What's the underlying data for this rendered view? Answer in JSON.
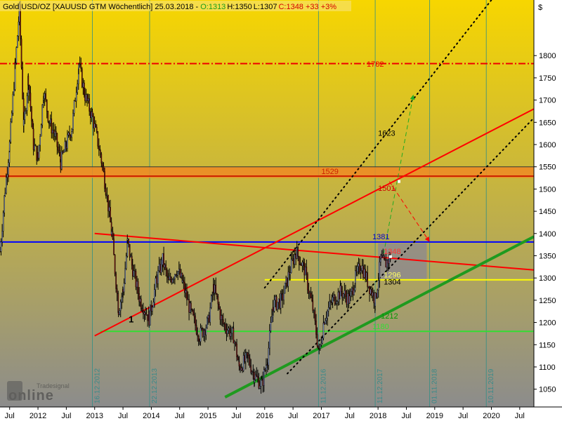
{
  "header": {
    "instrument": "Gold USD/OZ [XAUUSD GTM  Wöchentlich] 25.03.2018 - ",
    "open": "O:1313",
    "high": "H:1350",
    "low": "L:1307",
    "close": "C:1348 +33 +3%"
  },
  "watermark": {
    "brand": "online",
    "sub": "Tradesignal"
  },
  "colors": {
    "bg_top": "#f7d600",
    "bg_bottom": "#8c8c8c",
    "up": "#8fa3d9",
    "down": "#7a1010",
    "wick": "#000000",
    "red": "#ff0000",
    "green": "#22bb22",
    "darkgreen": "#1f9a1f",
    "blue": "#0000ff",
    "yellow": "#ffff33",
    "orange": "#f08a24",
    "teal": "#2f8f87",
    "label_green": "#009900"
  },
  "chart_data": {
    "type": "candlestick",
    "x": {
      "start": 2011.33,
      "end": 2020.75
    },
    "ylim": [
      1010,
      1925
    ],
    "currency": "$",
    "y_ticks": [
      1050,
      1100,
      1150,
      1200,
      1250,
      1300,
      1350,
      1400,
      1450,
      1500,
      1550,
      1600,
      1650,
      1700,
      1750,
      1800
    ],
    "x_ticks": [
      {
        "label": "Jul",
        "t": 2011.5
      },
      {
        "label": "2012",
        "t": 2012.0
      },
      {
        "label": "Jul",
        "t": 2012.5
      },
      {
        "label": "2013",
        "t": 2013.0
      },
      {
        "label": "Jul",
        "t": 2013.5
      },
      {
        "label": "2014",
        "t": 2014.0
      },
      {
        "label": "Jul",
        "t": 2014.5
      },
      {
        "label": "2015",
        "t": 2015.0
      },
      {
        "label": "Jul",
        "t": 2015.5
      },
      {
        "label": "2016",
        "t": 2016.0
      },
      {
        "label": "Jul",
        "t": 2016.5
      },
      {
        "label": "2017",
        "t": 2017.0
      },
      {
        "label": "Jul",
        "t": 2017.5
      },
      {
        "label": "2018",
        "t": 2018.0
      },
      {
        "label": "Jul",
        "t": 2018.5
      },
      {
        "label": "2019",
        "t": 2019.0
      },
      {
        "label": "Jul",
        "t": 2019.5
      },
      {
        "label": "2020",
        "t": 2020.0
      },
      {
        "label": "Jul",
        "t": 2020.5
      }
    ],
    "vertical_markers": [
      {
        "t": 2012.96,
        "label": "16.12.2012"
      },
      {
        "t": 2013.97,
        "label": "22.12.2013"
      },
      {
        "t": 2016.95,
        "label": "11.12.2016"
      },
      {
        "t": 2017.95,
        "label": "11.12.2017"
      },
      {
        "t": 2018.91,
        "label": "01.11.2018"
      },
      {
        "t": 2019.91,
        "label": "10.11.2019"
      }
    ],
    "horizontal_levels": [
      {
        "name": "h1782",
        "value": 1782,
        "label": "1782",
        "color": "#ee0000",
        "dash": "dashdot"
      },
      {
        "name": "h1529",
        "value": 1529,
        "label": "1529",
        "color": "#cc2200",
        "dash": "solid"
      },
      {
        "name": "h1381",
        "value": 1381,
        "label": "1381",
        "color": "#0000ff",
        "dash": "solid"
      },
      {
        "name": "h1296",
        "value": 1296,
        "label": "1296",
        "color": "#ffff00",
        "dash": "solid"
      },
      {
        "name": "h1180",
        "value": 1180,
        "label": "1180",
        "color": "#33dd33",
        "dash": "solid"
      }
    ],
    "zone": {
      "from": 1525,
      "to": 1550
    },
    "trendlines": [
      {
        "name": "red-falling-line",
        "t1": 2013.0,
        "v1": 1400,
        "t2": 2020.75,
        "v2": 1318,
        "color": "#ff0000",
        "width": 2
      },
      {
        "name": "red-rising-line",
        "t1": 2013.0,
        "v1": 1170,
        "t2": 2020.75,
        "v2": 1680,
        "color": "#ff0000",
        "width": 2
      },
      {
        "name": "green-support-line",
        "t1": 2015.3,
        "v1": 1032,
        "t2": 2020.75,
        "v2": 1393,
        "color": "#1f9a1f",
        "width": 4
      },
      {
        "name": "dotted-upper-channel",
        "t1": 2016.0,
        "v1": 1278,
        "t2": 2020.0,
        "v2": 1925,
        "color": "#000000",
        "width": 2,
        "dotted": true
      },
      {
        "name": "dotted-lower-channel",
        "t1": 2016.4,
        "v1": 1085,
        "t2": 2020.75,
        "v2": 1660,
        "color": "#000000",
        "width": 2,
        "dotted": true
      },
      {
        "name": "green-dashed-target",
        "t1": 2018.1,
        "v1": 1355,
        "t2": 2018.62,
        "v2": 1710,
        "color": "#22aa22",
        "width": 1,
        "dashed": true,
        "arrow": true
      },
      {
        "name": "red-dashed-target",
        "t1": 2018.2,
        "v1": 1517,
        "t2": 2018.9,
        "v2": 1383,
        "color": "#ff0000",
        "width": 1,
        "dashed": true,
        "arrow": true
      }
    ],
    "annotations": [
      {
        "name": "label-1782",
        "text": "1782",
        "t": 2017.8,
        "v": 1775,
        "color": "#ee0000"
      },
      {
        "name": "label-1529",
        "text": "1529",
        "t": 2017.0,
        "v": 1534,
        "color": "#cc2200"
      },
      {
        "name": "label-1623",
        "text": "1623",
        "t": 2018.0,
        "v": 1620,
        "color": "#000000"
      },
      {
        "name": "label-1501",
        "text": "1501",
        "t": 2018.0,
        "v": 1496,
        "color": "#cc0000"
      },
      {
        "name": "label-1381",
        "text": "1381",
        "t": 2017.9,
        "v": 1387,
        "color": "#0000cc"
      },
      {
        "name": "label-1348",
        "text": "1348",
        "t": 2018.1,
        "v": 1354,
        "color": "#ff3333"
      },
      {
        "name": "label-1296",
        "text": "1296",
        "t": 2018.1,
        "v": 1301,
        "color": "#ffff66"
      },
      {
        "name": "label-1304",
        "text": "1304",
        "t": 2018.1,
        "v": 1285,
        "color": "#000000"
      },
      {
        "name": "label-1212",
        "text": "1212",
        "t": 2018.05,
        "v": 1209,
        "color": "#009900"
      },
      {
        "name": "label-1180",
        "text": "1180",
        "t": 2017.9,
        "v": 1185,
        "color": "#33dd33"
      },
      {
        "name": "label-1",
        "text": "1",
        "t": 2013.6,
        "v": 1200,
        "color": "#000000",
        "bold": true
      }
    ],
    "price_path": [
      [
        2011.33,
        1360
      ],
      [
        2011.42,
        1500
      ],
      [
        2011.5,
        1600
      ],
      [
        2011.6,
        1780
      ],
      [
        2011.67,
        1900
      ],
      [
        2011.75,
        1640
      ],
      [
        2011.83,
        1750
      ],
      [
        2011.92,
        1600
      ],
      [
        2012.0,
        1570
      ],
      [
        2012.1,
        1720
      ],
      [
        2012.2,
        1650
      ],
      [
        2012.3,
        1620
      ],
      [
        2012.4,
        1560
      ],
      [
        2012.5,
        1600
      ],
      [
        2012.6,
        1640
      ],
      [
        2012.72,
        1780
      ],
      [
        2012.83,
        1710
      ],
      [
        2012.96,
        1660
      ],
      [
        2013.1,
        1580
      ],
      [
        2013.2,
        1500
      ],
      [
        2013.3,
        1400
      ],
      [
        2013.42,
        1230
      ],
      [
        2013.5,
        1270
      ],
      [
        2013.58,
        1380
      ],
      [
        2013.67,
        1320
      ],
      [
        2013.8,
        1250
      ],
      [
        2013.96,
        1210
      ],
      [
        2014.1,
        1300
      ],
      [
        2014.2,
        1340
      ],
      [
        2014.3,
        1290
      ],
      [
        2014.45,
        1320
      ],
      [
        2014.55,
        1290
      ],
      [
        2014.7,
        1220
      ],
      [
        2014.85,
        1170
      ],
      [
        2015.0,
        1200
      ],
      [
        2015.1,
        1280
      ],
      [
        2015.25,
        1200
      ],
      [
        2015.45,
        1170
      ],
      [
        2015.55,
        1100
      ],
      [
        2015.7,
        1120
      ],
      [
        2015.82,
        1080
      ],
      [
        2015.95,
        1060
      ],
      [
        2016.05,
        1120
      ],
      [
        2016.15,
        1240
      ],
      [
        2016.3,
        1250
      ],
      [
        2016.45,
        1320
      ],
      [
        2016.55,
        1360
      ],
      [
        2016.7,
        1320
      ],
      [
        2016.85,
        1230
      ],
      [
        2016.96,
        1130
      ],
      [
        2017.05,
        1210
      ],
      [
        2017.2,
        1250
      ],
      [
        2017.35,
        1270
      ],
      [
        2017.5,
        1250
      ],
      [
        2017.6,
        1300
      ],
      [
        2017.7,
        1330
      ],
      [
        2017.85,
        1280
      ],
      [
        2017.95,
        1250
      ],
      [
        2018.05,
        1340
      ],
      [
        2018.12,
        1330
      ],
      [
        2018.22,
        1348
      ]
    ]
  }
}
